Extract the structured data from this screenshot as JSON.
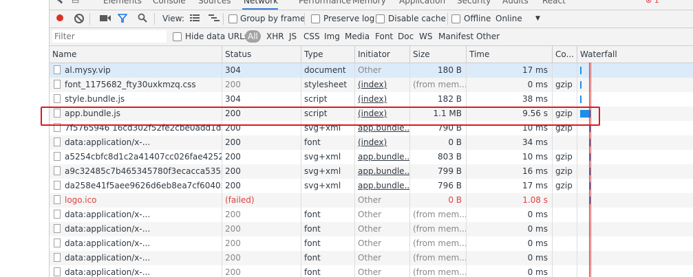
{
  "tabs": [
    "Elements",
    "Console",
    "Sources",
    "Network",
    "Performance",
    "Memory",
    "Application",
    "Security",
    "Audits",
    "React"
  ],
  "error_count": "1",
  "toolbar": {
    "view_label": "View:",
    "group_by_frame": "Group by frame",
    "preserve_log": "Preserve log",
    "disable_cache": "Disable cache",
    "offline": "Offline",
    "throttle": "Online"
  },
  "filterbar": {
    "placeholder": "Filter",
    "hide_data_urls": "Hide data URLs",
    "all": "All",
    "types": [
      "XHR",
      "JS",
      "CSS",
      "Img",
      "Media",
      "Font",
      "Doc",
      "WS",
      "Manifest",
      "Other"
    ]
  },
  "columns": [
    "Name",
    "Status",
    "Type",
    "Initiator",
    "Size",
    "Time",
    "Co...",
    "Waterfall"
  ],
  "rows": [
    {
      "name": "al.mysy.vip",
      "status": "304",
      "type": "document",
      "initiator": "Other",
      "size": "180 B",
      "time": "17 ms",
      "co": ""
    },
    {
      "name": "font_1175682_fty30uxkmzq.css",
      "status": "200",
      "type": "stylesheet",
      "initiator": "(index)",
      "size": "(from mem...",
      "time": "0 ms",
      "co": "gzip"
    },
    {
      "name": "style.bundle.js",
      "status": "304",
      "type": "script",
      "initiator": "(index)",
      "size": "182 B",
      "time": "38 ms",
      "co": ""
    },
    {
      "name": "app.bundle.js",
      "status": "200",
      "type": "script",
      "initiator": "(index)",
      "size": "1.1 MB",
      "time": "9.56 s",
      "co": "gzip"
    },
    {
      "name": "7f5765946 16cd302f52fe2cbe0add1d0.svg",
      "status": "200",
      "type": "svg+xml",
      "initiator": "app.bundle...",
      "size": "790 B",
      "time": "10 ms",
      "co": "gzip"
    },
    {
      "name": "data:application/x-...",
      "status": "200",
      "type": "font",
      "initiator": "(index)",
      "size": "0 B",
      "time": "34 ms",
      "co": ""
    },
    {
      "name": "a5254cbfc8d1c2a41407cc026fae4252.svg",
      "status": "200",
      "type": "svg+xml",
      "initiator": "app.bundle...",
      "size": "803 B",
      "time": "10 ms",
      "co": "gzip"
    },
    {
      "name": "a9c32485c7b465345780f3ecacca5352.svg",
      "status": "200",
      "type": "svg+xml",
      "initiator": "app.bundle...",
      "size": "799 B",
      "time": "16 ms",
      "co": "gzip"
    },
    {
      "name": "da258e41f5aee9626d6eb8ea7cf60405.svg",
      "status": "200",
      "type": "svg+xml",
      "initiator": "app.bundle...",
      "size": "796 B",
      "time": "17 ms",
      "co": "gzip"
    },
    {
      "name": "logo.ico",
      "status": "(failed)",
      "type": "",
      "initiator": "Other",
      "size": "0 B",
      "time": "1.08 s",
      "co": ""
    },
    {
      "name": "data:application/x-...",
      "status": "200",
      "type": "font",
      "initiator": "Other",
      "size": "(from mem...",
      "time": "0 ms",
      "co": ""
    },
    {
      "name": "data:application/x-...",
      "status": "200",
      "type": "font",
      "initiator": "Other",
      "size": "(from mem...",
      "time": "0 ms",
      "co": ""
    },
    {
      "name": "data:application/x-...",
      "status": "200",
      "type": "font",
      "initiator": "Other",
      "size": "(from mem...",
      "time": "0 ms",
      "co": ""
    },
    {
      "name": "data:application/x-...",
      "status": "200",
      "type": "font",
      "initiator": "Other",
      "size": "(from mem...",
      "time": "0 ms",
      "co": ""
    },
    {
      "name": "data:application/x-...",
      "status": "200",
      "type": "font",
      "initiator": "Other",
      "size": "(from mem...",
      "time": "0 ms",
      "co": ""
    }
  ],
  "colors": {
    "accent": "#1c8fe9",
    "record": "#d93025",
    "failed": "#e0413f",
    "highlight": "#e0151d"
  }
}
